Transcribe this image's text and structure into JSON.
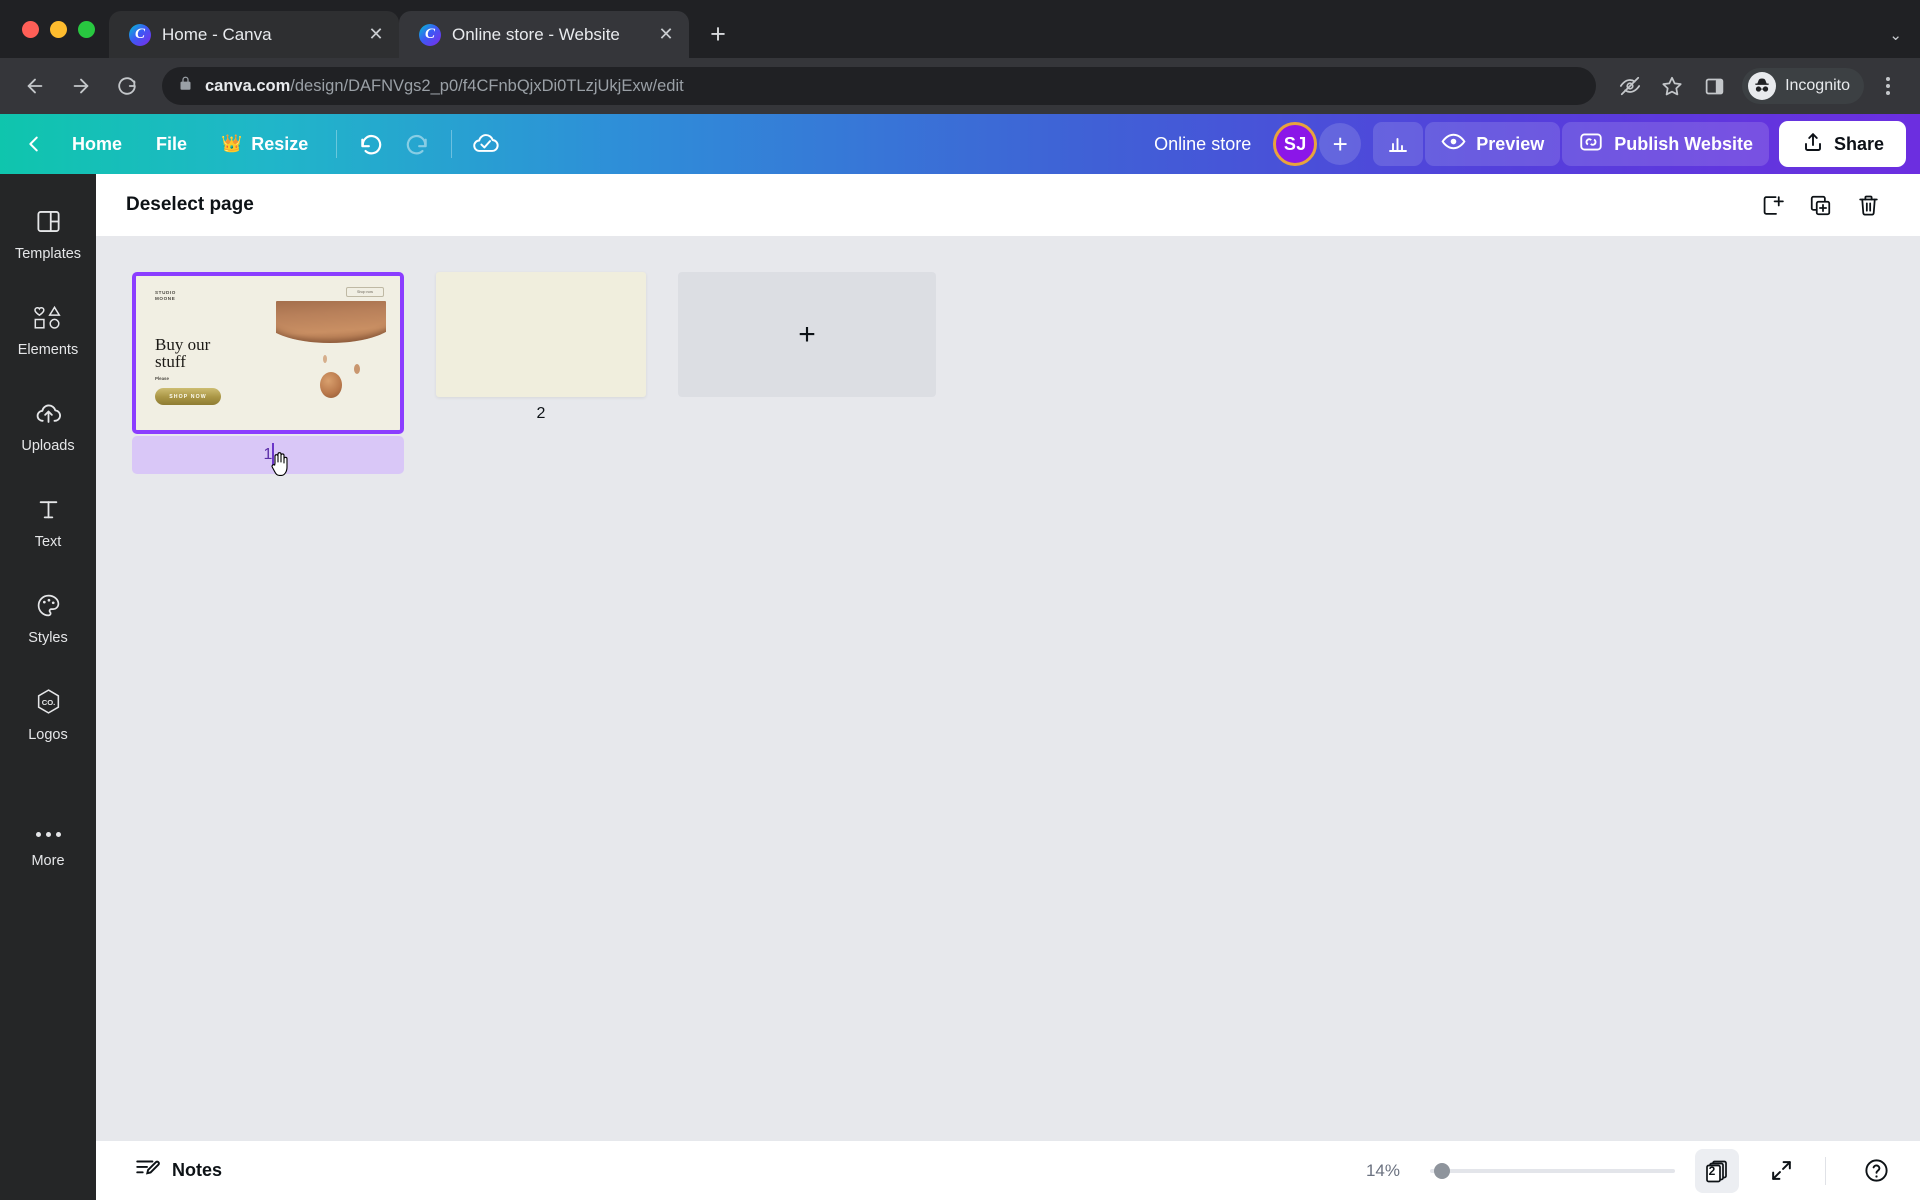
{
  "browser": {
    "tabs": [
      {
        "title": "Home - Canva",
        "active": false,
        "favicon": "canva-favicon"
      },
      {
        "title": "Online store - Website",
        "active": true,
        "favicon": "canva-favicon"
      }
    ],
    "new_tab_label": "+",
    "tab_list_caret": "⌄",
    "close_label": "✕",
    "url_domain": "canva.com",
    "url_path": "/design/DAFNVgs2_p0/f4CFnbQjxDi0TLzjUkjExw/edit",
    "profile_label": "Incognito",
    "icons": [
      "back-arrow",
      "forward-arrow",
      "reload",
      "lock",
      "eye-off",
      "bookmark-star",
      "side-panel",
      "incognito",
      "kebab-menu"
    ]
  },
  "canva_toolbar": {
    "back_label": "‹",
    "home_label": "Home",
    "file_label": "File",
    "resize_label": "Resize",
    "resize_badge": "👑",
    "undo_label": "undo",
    "redo_label": "redo",
    "cloud_status": "saved-to-cloud",
    "doc_title": "Online store",
    "avatar_initials": "SJ",
    "avatar_bg": "#8b16e8",
    "avatar_ring": "#e8a33d",
    "add_collaborator": "+",
    "insights_label": "insights",
    "preview_label": "Preview",
    "publish_label": "Publish Website",
    "share_label": "Share",
    "gradient_from": "#0fc5ad",
    "gradient_to": "#6c2ee0"
  },
  "sidebar": {
    "items": [
      {
        "label": "Templates",
        "icon": "templates-icon"
      },
      {
        "label": "Elements",
        "icon": "elements-icon"
      },
      {
        "label": "Uploads",
        "icon": "uploads-icon"
      },
      {
        "label": "Text",
        "icon": "text-icon"
      },
      {
        "label": "Styles",
        "icon": "styles-icon"
      },
      {
        "label": "Logos",
        "icon": "logos-icon"
      },
      {
        "label": "More",
        "icon": "more-icon"
      }
    ],
    "logos_icon_text": "CO."
  },
  "page_header": {
    "title": "Deselect page",
    "actions": [
      {
        "name": "add-page",
        "icon": "add-page-icon"
      },
      {
        "name": "duplicate-page",
        "icon": "duplicate-page-icon"
      },
      {
        "name": "delete-page",
        "icon": "trash-icon"
      }
    ]
  },
  "pages": [
    {
      "number": "1",
      "selected": true,
      "thumbnail": {
        "logo": "STUDIO\nMOONE",
        "nav_button": "Shop now",
        "heading": "Buy our\nstuff",
        "subtext": "Please",
        "cta": "SHOP NOW",
        "bg_color": "#f1efe3",
        "photo_alt": "jewelry-necklaces-photo"
      }
    },
    {
      "number": "2",
      "selected": false,
      "thumbnail": {
        "bg_color": "#f0eedd"
      }
    }
  ],
  "add_page_tile": {
    "label": "+"
  },
  "bottom_bar": {
    "notes_label": "Notes",
    "zoom_level": "14%",
    "page_count": "2",
    "fullscreen_label": "fullscreen",
    "help_label": "?"
  }
}
